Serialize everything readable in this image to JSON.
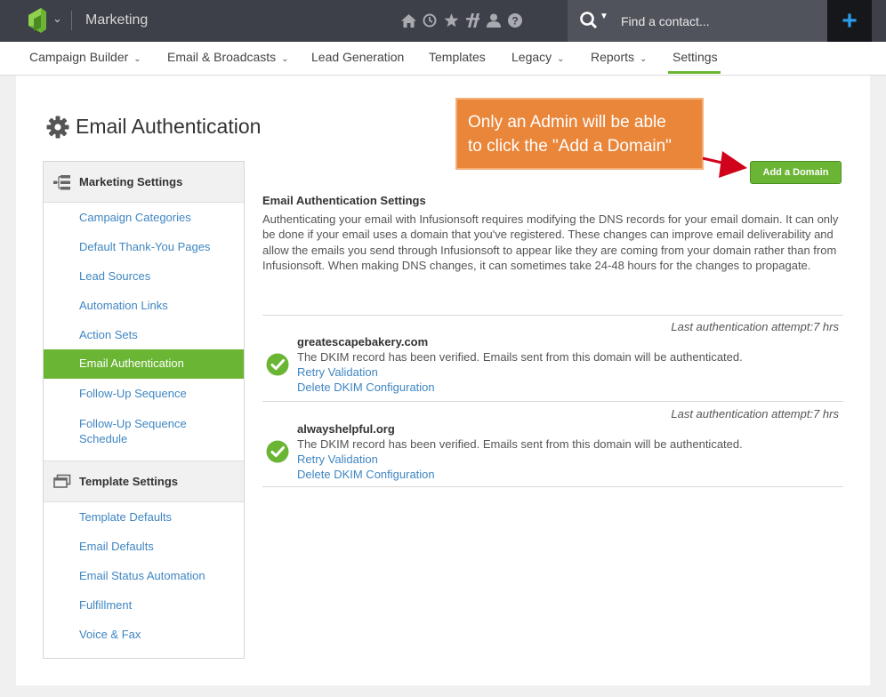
{
  "topbar": {
    "app_title": "Marketing",
    "search_placeholder": "Find a contact...",
    "plus_label": "+",
    "icons": [
      "home-icon",
      "clock-icon",
      "star-icon",
      "integrations-icon",
      "user-icon",
      "help-icon"
    ]
  },
  "nav": {
    "items": [
      {
        "label": "Campaign Builder",
        "has_caret": true
      },
      {
        "label": "Email & Broadcasts",
        "has_caret": true
      },
      {
        "label": "Lead Generation",
        "has_caret": false
      },
      {
        "label": "Templates",
        "has_caret": false
      },
      {
        "label": "Legacy",
        "has_caret": true
      },
      {
        "label": "Reports",
        "has_caret": true
      },
      {
        "label": "Settings",
        "has_caret": false,
        "active": true
      }
    ]
  },
  "page": {
    "title": "Email Authentication"
  },
  "sidebar": {
    "marketing_heading": "Marketing Settings",
    "marketing_items": [
      "Campaign Categories",
      "Default Thank-You Pages",
      "Lead Sources",
      "Automation Links",
      "Action Sets",
      "Email Authentication",
      "Follow-Up Sequence",
      "Follow-Up Sequence Schedule"
    ],
    "template_heading": "Template Settings",
    "template_items": [
      "Template Defaults",
      "Email Defaults",
      "Email Status Automation",
      "Fulfillment",
      "Voice & Fax"
    ]
  },
  "annotation": {
    "line1": "Only an Admin will be able",
    "line2": "to click the \"Add a Domain\""
  },
  "main": {
    "add_domain_label": "Add a Domain",
    "section_title": "Email Authentication Settings",
    "section_description": "Authenticating your email with Infusionsoft requires modifying the DNS records for your email domain. It can only be done if your email uses a domain that you've registered. These changes can improve email deliverability and allow the emails you send through Infusionsoft to appear like they are coming from your domain rather than from Infusionsoft. When making DNS changes, it can sometimes take 24-48 hours for the changes to propagate.",
    "domains": [
      {
        "last_attempt": "Last authentication attempt:7 hrs",
        "domain": "greatescapebakery.com",
        "message": "The DKIM record has been verified. Emails sent from this domain will be authenticated.",
        "retry_label": "Retry Validation",
        "delete_label": "Delete DKIM Configuration"
      },
      {
        "last_attempt": "Last authentication attempt:7 hrs",
        "domain": "alwayshelpful.org",
        "message": "The DKIM record has been verified. Emails sent from this domain will be authenticated.",
        "retry_label": "Retry Validation",
        "delete_label": "Delete DKIM Configuration"
      }
    ]
  },
  "colors": {
    "topbar": "#3d4049",
    "accent_green": "#6bb535",
    "link_blue": "#3f86c2",
    "callout_orange": "#e9863a",
    "plus_blue": "#2a9be8"
  }
}
